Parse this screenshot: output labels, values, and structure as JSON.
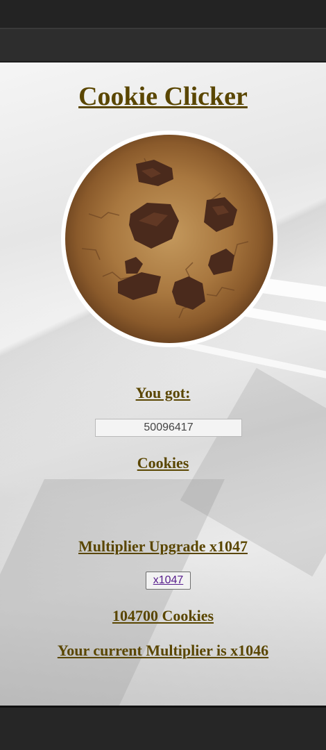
{
  "title": "Cookie Clicker",
  "cookie": {
    "icon": "cookie-icon"
  },
  "counter": {
    "label": "You got:",
    "value": "50096417",
    "unit": "Cookies"
  },
  "upgrade": {
    "title": "Multiplier Upgrade x1047",
    "button_label": "x1047",
    "cost": "104700 Cookies",
    "current_multiplier": "Your current Multiplier is x1046"
  },
  "colors": {
    "heading": "#5a4600",
    "link": "#551a8b",
    "chrome_dark": "#232323"
  }
}
